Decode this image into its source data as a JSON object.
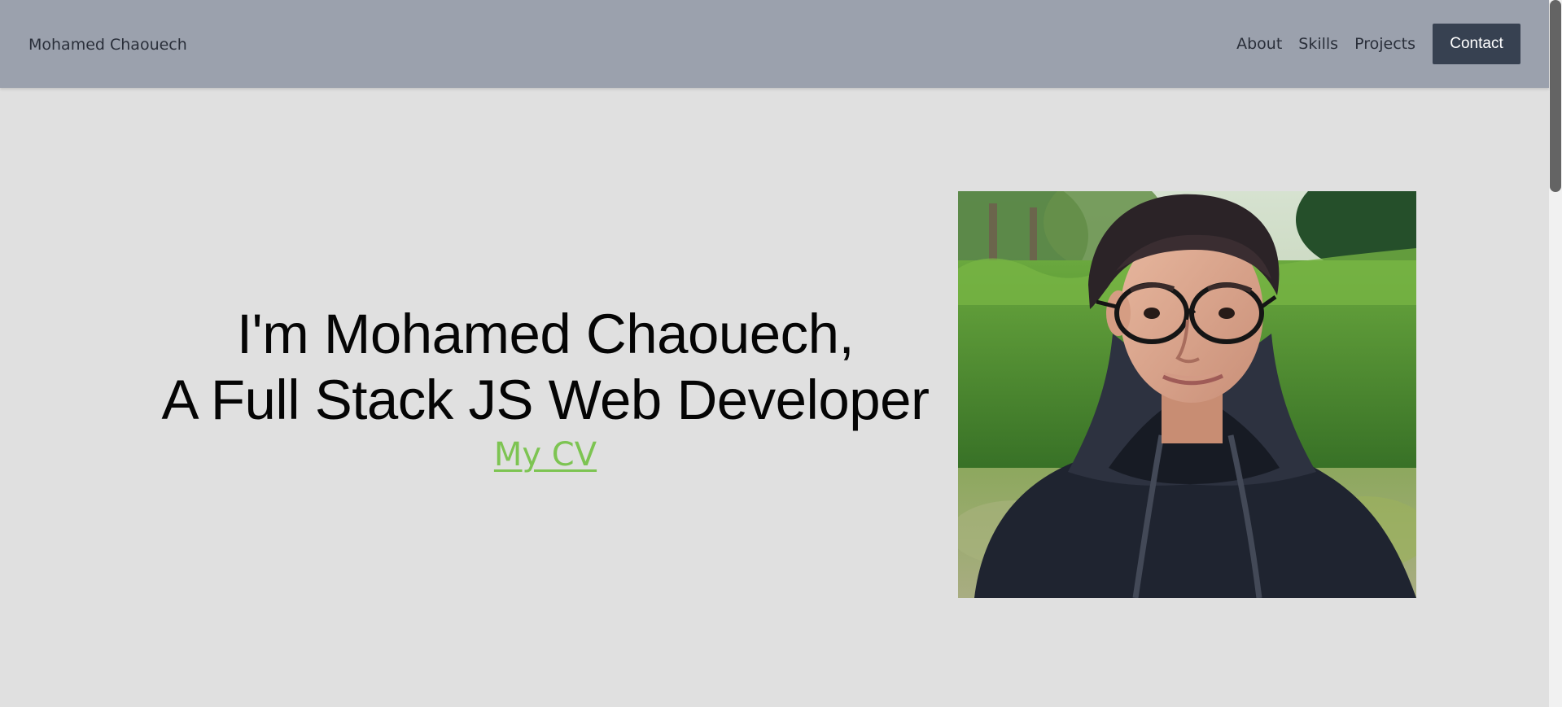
{
  "header": {
    "brand": "Mohamed Chaouech",
    "nav": [
      {
        "label": "About"
      },
      {
        "label": "Skills"
      },
      {
        "label": "Projects"
      }
    ],
    "contact_label": "Contact"
  },
  "hero": {
    "title_line1": "I'm Mohamed Chaouech,",
    "title_line2": "A Full Stack JS Web Developer",
    "cv_link": "My CV",
    "photo_icon": "profile-photo"
  },
  "colors": {
    "header_bg": "#9ba1ad",
    "page_bg": "#e0e0e0",
    "contact_button": "#374151",
    "cv_link": "#7dc452"
  }
}
